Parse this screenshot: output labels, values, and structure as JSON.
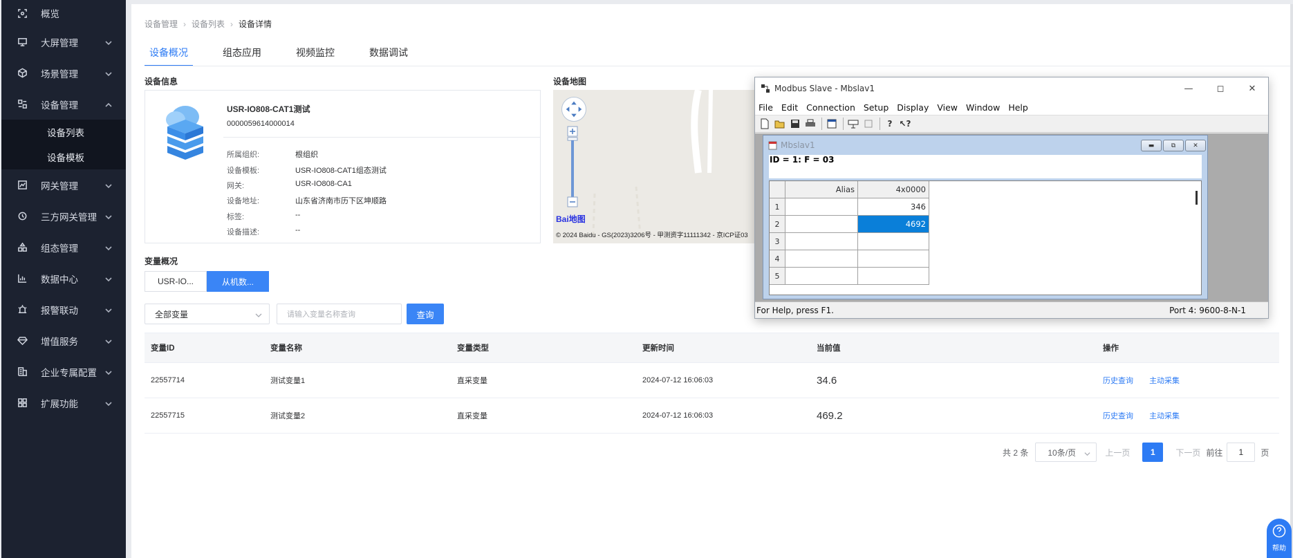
{
  "sidebar": {
    "items": [
      {
        "label": "概览",
        "icon": "overview-icon"
      },
      {
        "label": "大屏管理",
        "icon": "screen-icon"
      },
      {
        "label": "场景管理",
        "icon": "scene-icon"
      },
      {
        "label": "设备管理",
        "icon": "device-icon"
      },
      {
        "label": "网关管理",
        "icon": "gateway-icon"
      },
      {
        "label": "三方网关管理",
        "icon": "thirdparty-icon"
      },
      {
        "label": "组态管理",
        "icon": "config-icon"
      },
      {
        "label": "数据中心",
        "icon": "chart-icon"
      },
      {
        "label": "报警联动",
        "icon": "alarm-icon"
      },
      {
        "label": "增值服务",
        "icon": "diamond-icon"
      },
      {
        "label": "企业专属配置",
        "icon": "enterprise-icon"
      },
      {
        "label": "扩展功能",
        "icon": "grid-icon"
      }
    ],
    "submenu": [
      "设备列表",
      "设备模板"
    ]
  },
  "breadcrumb": [
    "设备管理",
    "设备列表",
    "设备详情"
  ],
  "tabs": [
    "设备概况",
    "组态应用",
    "视频监控",
    "数据调试"
  ],
  "device_info": {
    "section_title": "设备信息",
    "name": "USR-IO808-CAT1测试",
    "id": "0000059614000014",
    "fields": [
      {
        "k": "所属组织:",
        "v": "根组织"
      },
      {
        "k": "设备模板:",
        "v": "USR-IO808-CAT1组态测试"
      },
      {
        "k": "网关:",
        "v": "USR-IO808-CA1"
      },
      {
        "k": "设备地址:",
        "v": "山东省济南市历下区坤顺路"
      },
      {
        "k": "标签:",
        "v": "--"
      },
      {
        "k": "设备描述:",
        "v": "--"
      }
    ]
  },
  "map": {
    "section_title": "设备地图",
    "logo_a": "Bai",
    "logo_b": "地图",
    "footer": "© 2024 Baidu - GS(2023)3206号 - 甲测资字11111342 - 京ICP证03"
  },
  "variables": {
    "section_title": "变量概况",
    "tabs": [
      "USR-IO...",
      "从机数..."
    ],
    "filter_selected": "全部变量",
    "search_placeholder": "请输入变量名称查询",
    "query_label": "查询",
    "columns": [
      "变量ID",
      "变量名称",
      "变量类型",
      "更新时间",
      "当前值",
      "操作"
    ],
    "rows": [
      {
        "id": "22557714",
        "name": "测试变量1",
        "type": "直采变量",
        "time": "2024-07-12 16:06:03",
        "value": "34.6",
        "a1": "历史查询",
        "a2": "主动采集"
      },
      {
        "id": "22557715",
        "name": "测试变量2",
        "type": "直采变量",
        "time": "2024-07-12 16:06:03",
        "value": "469.2",
        "a1": "历史查询",
        "a2": "主动采集"
      }
    ]
  },
  "pagination": {
    "total": "共 2 条",
    "page_size": "10条/页",
    "prev": "上一页",
    "current": "1",
    "next": "下一页",
    "goto": "前往",
    "goto_value": "1",
    "unit": "页"
  },
  "help": {
    "label": "帮助"
  },
  "modbus": {
    "title": "Modbus Slave - Mbslav1",
    "menu": [
      "File",
      "Edit",
      "Connection",
      "Setup",
      "Display",
      "View",
      "Window",
      "Help"
    ],
    "child_title": "Mbslav1",
    "info": "ID = 1: F = 03",
    "grid_header": {
      "alias": "Alias",
      "col": "4x0000"
    },
    "grid_rows": [
      {
        "n": "1",
        "alias": "",
        "val": "346"
      },
      {
        "n": "2",
        "alias": "",
        "val": "4692"
      },
      {
        "n": "3",
        "alias": "",
        "val": ""
      },
      {
        "n": "4",
        "alias": "",
        "val": ""
      },
      {
        "n": "5",
        "alias": "",
        "val": ""
      }
    ],
    "status_left": "For Help, press F1.",
    "status_right": "Port 4: 9600-8-N-1"
  },
  "colors": {
    "accent": "#2d7bf4",
    "sidebar_bg": "#1c2230",
    "selected_cell": "#0a7fd9"
  }
}
